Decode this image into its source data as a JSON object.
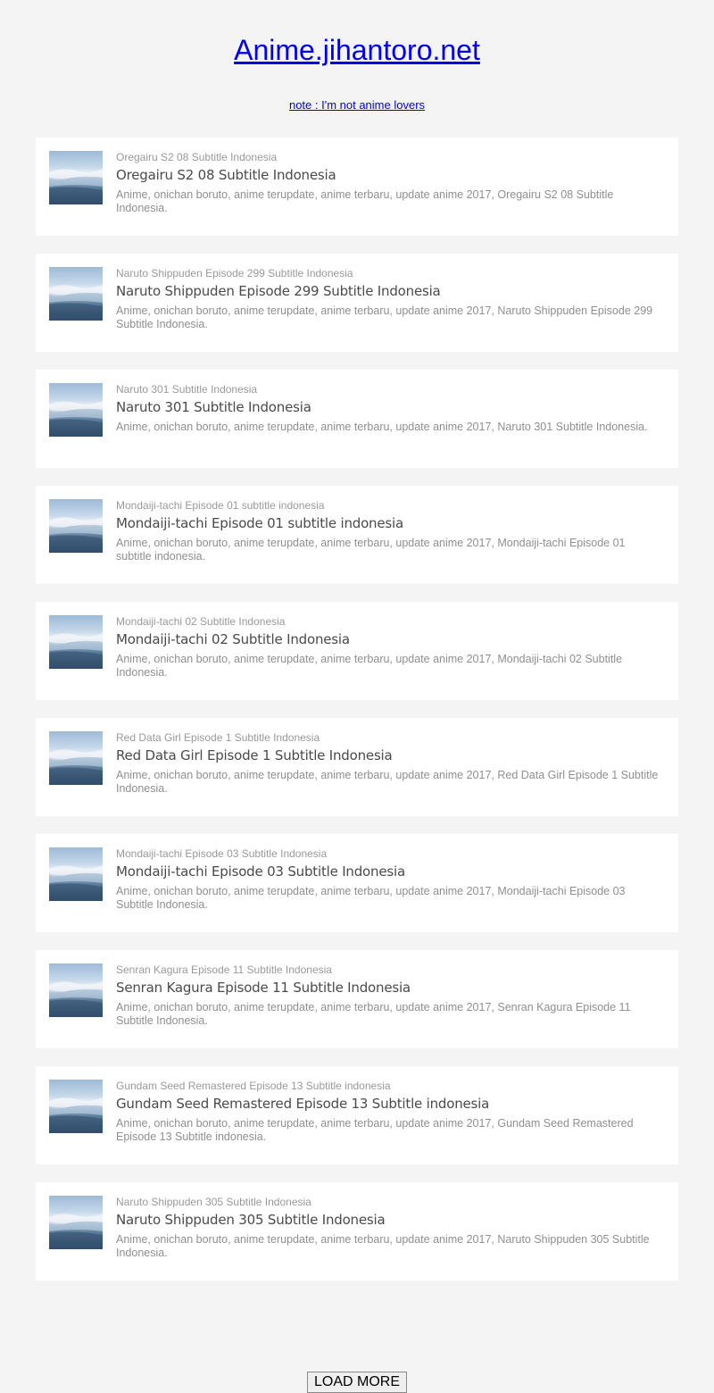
{
  "header": {
    "site_title": "Anime.jihantoro.net",
    "note": "note : I'm not anime lovers"
  },
  "posts": [
    {
      "label": "Oregairu S2 08 Subtitle Indonesia",
      "title": "Oregairu S2 08 Subtitle Indonesia",
      "description": "Anime, onichan boruto, anime terupdate, anime terbaru, update anime 2017, Oregairu S2 08 Subtitle Indonesia.",
      "thumbnail_icon": "sky-landscape-thumbnail"
    },
    {
      "label": "Naruto Shippuden Episode 299 Subtitle Indonesia",
      "title": "Naruto Shippuden Episode 299 Subtitle Indonesia",
      "description": "Anime, onichan boruto, anime terupdate, anime terbaru, update anime 2017, Naruto Shippuden Episode 299 Subtitle Indonesia.",
      "thumbnail_icon": "sky-landscape-thumbnail"
    },
    {
      "label": "Naruto 301 Subtitle Indonesia",
      "title": "Naruto 301 Subtitle Indonesia",
      "description": "Anime, onichan boruto, anime terupdate, anime terbaru, update anime 2017, Naruto 301 Subtitle Indonesia.",
      "thumbnail_icon": "sky-landscape-thumbnail"
    },
    {
      "label": "Mondaiji-tachi Episode 01 subtitle indonesia",
      "title": "Mondaiji-tachi Episode 01 subtitle indonesia",
      "description": "Anime, onichan boruto, anime terupdate, anime terbaru, update anime 2017, Mondaiji-tachi Episode 01 subtitle indonesia.",
      "thumbnail_icon": "sky-landscape-thumbnail"
    },
    {
      "label": "Mondaiji-tachi 02 Subtitle Indonesia",
      "title": "Mondaiji-tachi 02 Subtitle Indonesia",
      "description": "Anime, onichan boruto, anime terupdate, anime terbaru, update anime 2017, Mondaiji-tachi 02 Subtitle Indonesia.",
      "thumbnail_icon": "sky-landscape-thumbnail"
    },
    {
      "label": "Red Data Girl Episode 1 Subtitle Indonesia",
      "title": "Red Data Girl Episode 1 Subtitle Indonesia",
      "description": "Anime, onichan boruto, anime terupdate, anime terbaru, update anime 2017, Red Data Girl Episode 1 Subtitle Indonesia.",
      "thumbnail_icon": "sky-landscape-thumbnail"
    },
    {
      "label": "Mondaiji-tachi Episode 03 Subtitle Indonesia",
      "title": "Mondaiji-tachi Episode 03 Subtitle Indonesia",
      "description": "Anime, onichan boruto, anime terupdate, anime terbaru, update anime 2017, Mondaiji-tachi Episode 03 Subtitle Indonesia.",
      "thumbnail_icon": "sky-landscape-thumbnail"
    },
    {
      "label": "Senran Kagura Episode 11 Subtitle Indonesia",
      "title": "Senran Kagura Episode 11 Subtitle Indonesia",
      "description": "Anime, onichan boruto, anime terupdate, anime terbaru, update anime 2017, Senran Kagura Episode 11 Subtitle Indonesia.",
      "thumbnail_icon": "sky-landscape-thumbnail"
    },
    {
      "label": "Gundam Seed Remastered Episode 13 Subtitle indonesia",
      "title": "Gundam Seed Remastered Episode 13 Subtitle indonesia",
      "description": "Anime, onichan boruto, anime terupdate, anime terbaru, update anime 2017, Gundam Seed Remastered Episode 13 Subtitle indonesia.",
      "thumbnail_icon": "sky-landscape-thumbnail"
    },
    {
      "label": "Naruto Shippuden 305 Subtitle Indonesia",
      "title": "Naruto Shippuden 305 Subtitle Indonesia",
      "description": "Anime, onichan boruto, anime terupdate, anime terbaru, update anime 2017, Naruto Shippuden 305 Subtitle Indonesia.",
      "thumbnail_icon": "sky-landscape-thumbnail"
    }
  ],
  "footer": {
    "load_more_label": "LOAD MORE"
  },
  "colors": {
    "background": "#f4f4f4",
    "card": "#ffffff",
    "link": "#0000ee",
    "title_text": "#4a4a4a",
    "muted_text": "#999999"
  }
}
